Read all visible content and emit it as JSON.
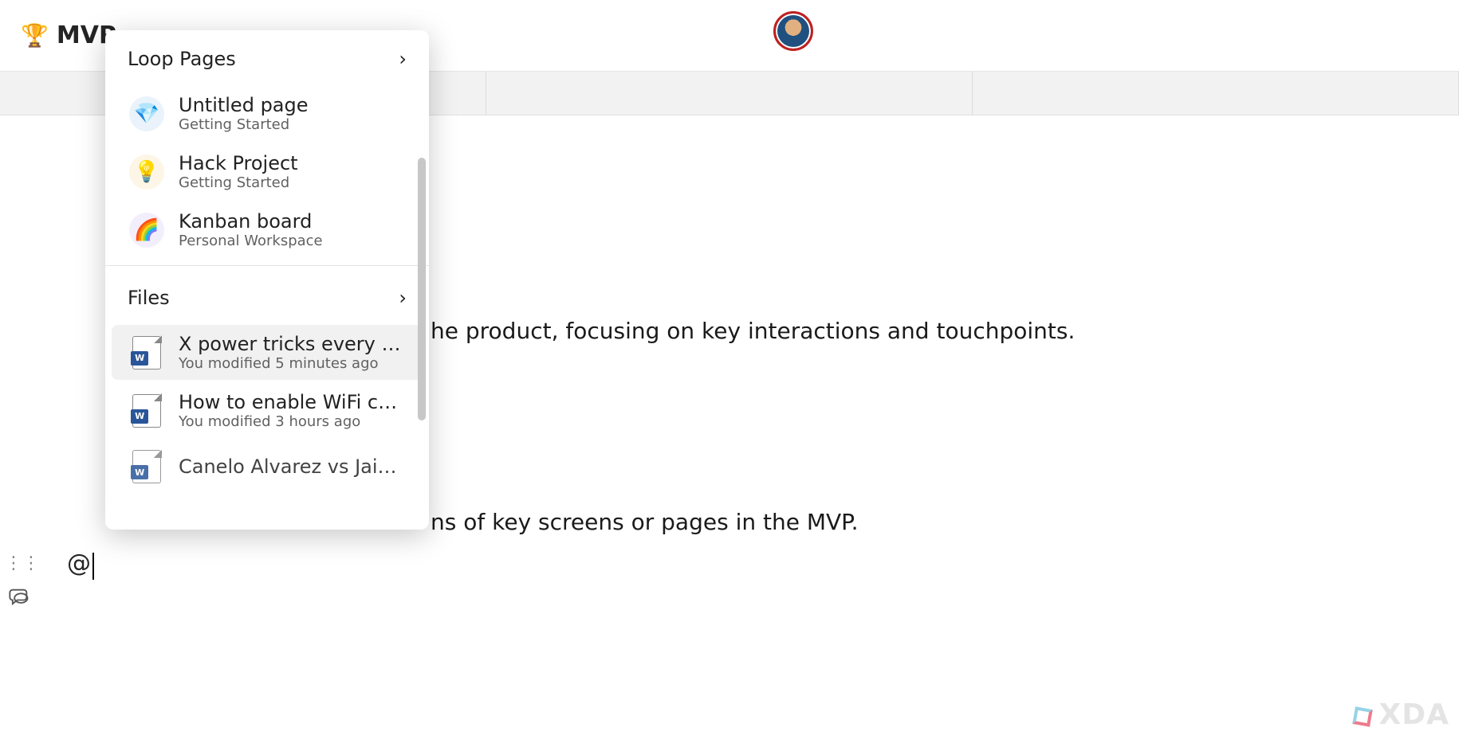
{
  "header": {
    "emoji": "🏆",
    "title": "MVP"
  },
  "popover": {
    "sections": {
      "pages": {
        "label": "Loop Pages",
        "items": [
          {
            "icon": "💎",
            "title": "Untitled page",
            "sub": "Getting Started"
          },
          {
            "icon": "💡",
            "title": "Hack Project",
            "sub": "Getting Started"
          },
          {
            "icon": "🌈",
            "title": "Kanban board",
            "sub": "Personal Workspace"
          }
        ]
      },
      "files": {
        "label": "Files",
        "items": [
          {
            "badge": "W",
            "title": "X power tricks every Micro…",
            "sub": "You modified 5 minutes ago"
          },
          {
            "badge": "W",
            "title": "How to enable WiFi caling…",
            "sub": "You modified 3 hours ago"
          },
          {
            "badge": "W",
            "title": "Canelo Alvarez vs Jaime M",
            "sub": ""
          }
        ]
      }
    }
  },
  "doc": {
    "line1": "he product, focusing on key interactions and touchpoints.",
    "line2": "ns of key screens or pages in the MVP.",
    "mention_trigger": "@"
  },
  "watermark": "XDA"
}
